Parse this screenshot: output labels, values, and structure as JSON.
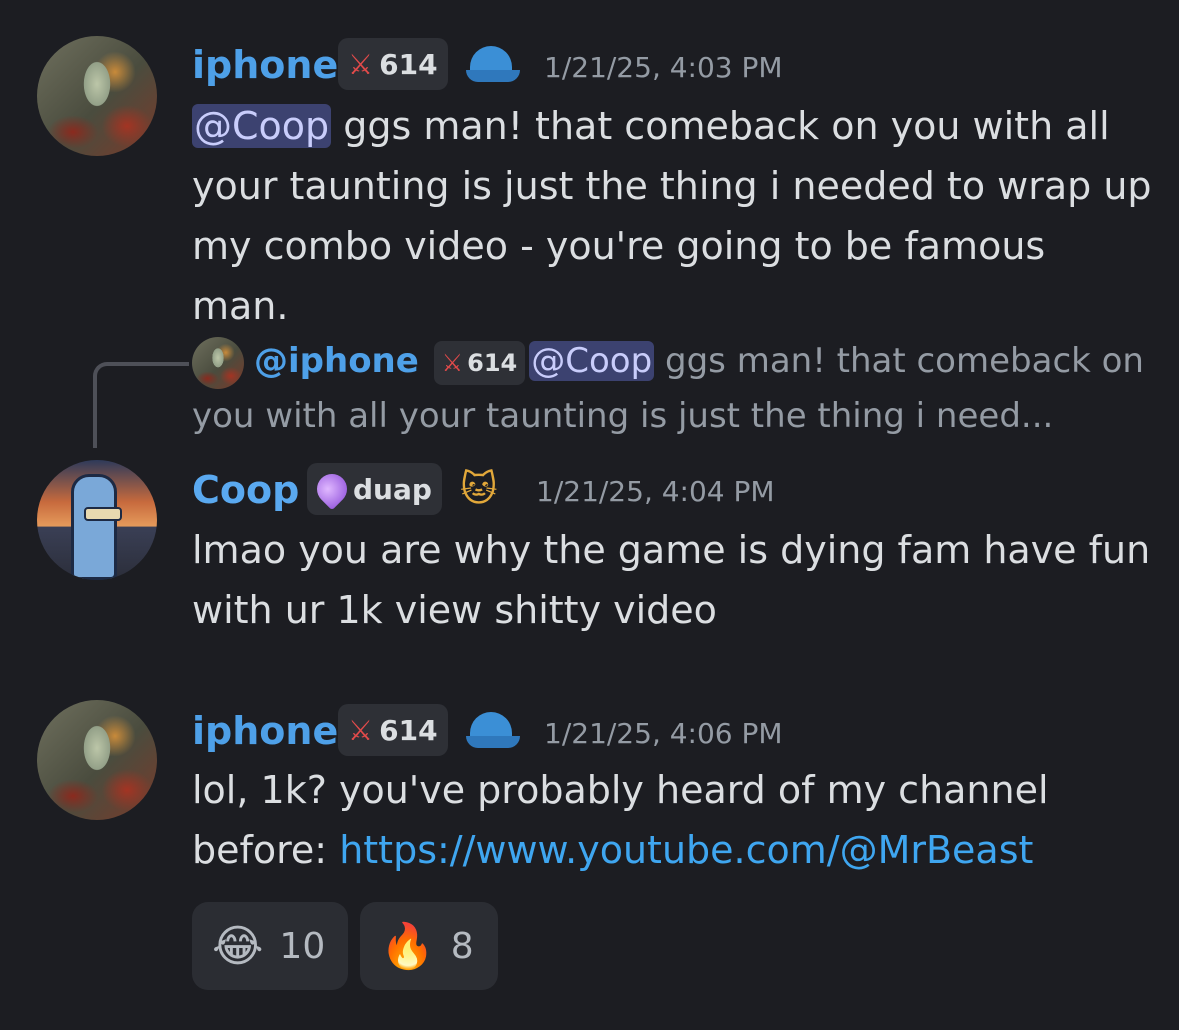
{
  "messages": [
    {
      "author": "iphone",
      "badge_value": "614",
      "timestamp": "1/21/25, 4:03 PM",
      "mention": "@Coop",
      "text": " ggs man! that comeback on you with all your taunting is just the thing i needed to wrap up my combo video - you're going to be famous man."
    },
    {
      "reply": {
        "author": "@iphone",
        "badge_value": "614",
        "mention": "@Coop",
        "text": " ggs man! that comeback on you with all your taunting is just the thing i need..."
      },
      "author": "Coop",
      "badge_value": "duap",
      "timestamp": "1/21/25, 4:04 PM",
      "text": "lmao you are why the game is dying fam have fun with ur 1k view shitty video"
    },
    {
      "author": "iphone",
      "badge_value": "614",
      "timestamp": "1/21/25, 4:06 PM",
      "text": "lol, 1k? you've probably heard of my channel before: ",
      "link": "https://www.youtube.com/@MrBeast",
      "reactions": [
        {
          "emoji": "😂",
          "count": "10"
        },
        {
          "emoji": "🔥",
          "count": "8"
        }
      ]
    }
  ]
}
